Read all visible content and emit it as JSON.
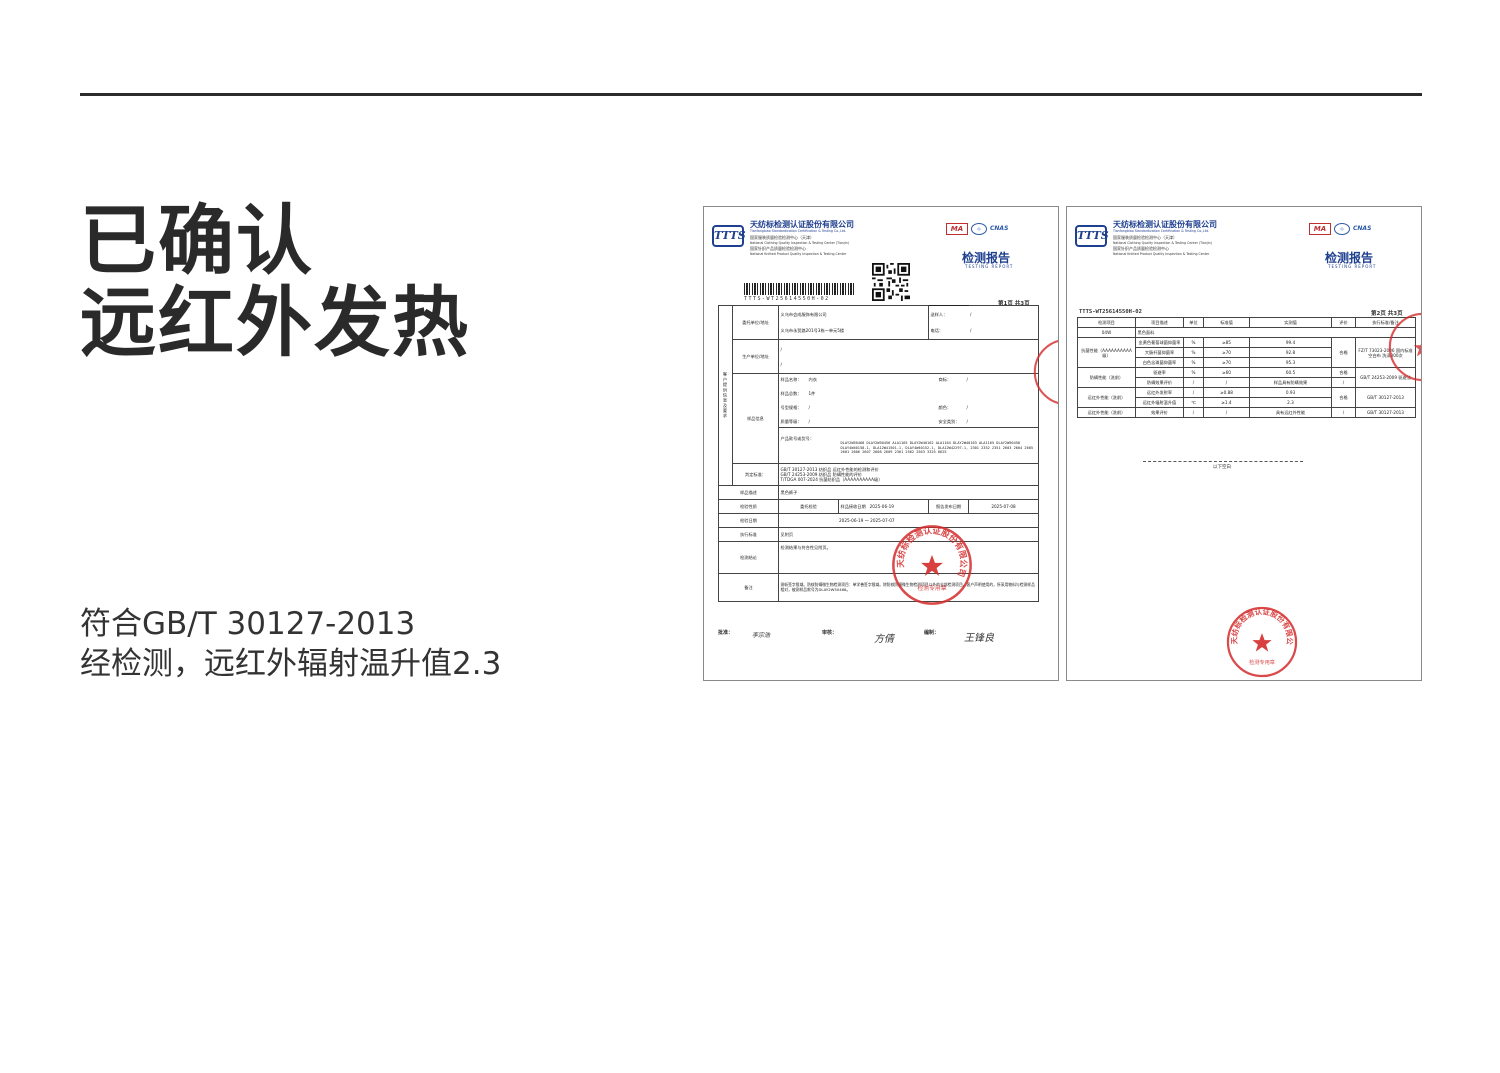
{
  "headline": {
    "line1": "已确认",
    "line2": "远红外发热"
  },
  "description": {
    "line1": "符合GB/T 30127-2013",
    "line2": "经检测，远红外辐射温升值2.3"
  },
  "lab": {
    "logo": "TTTS",
    "name": "天纺标检测认证股份有限公司",
    "name_en": "Tianfangbiao Standardization Certification & Testing Co.,Ltd.",
    "sub1": "国家服装质量检验检测中心（天津）",
    "sub1_en": "National Clothing Quality Inspection & Testing Center (Tianjin)",
    "sub2": "国家针织产品质量检验检测中心",
    "sub2_en": "National Knitted Product Quality Inspection & Testing Center",
    "mark_ma": "MA",
    "mark_cnas": "CNAS"
  },
  "report_title": "检测报告",
  "report_title_en": "TESTING REPORT",
  "page1": {
    "barcode_number": "TTTS-WT25614550H-02",
    "page_label": "第1页 共3页",
    "client_group": "客户提供信息及要求",
    "rows": {
      "client_label": "委托单位/地址",
      "client_name": "义乌市会成服饰有限公司",
      "client_addr": "义乌市永贸路201号3栋一单元5楼",
      "sender_label": "送样人：",
      "sender_val": "/",
      "phone_label": "电话：",
      "phone_val": "/",
      "producer_label": "生产单位/地址",
      "producer_val1": "/",
      "producer_val2": "/",
      "sample_info_label": "样品信息",
      "sample_name_label": "样品名称：",
      "sample_name": "内衣",
      "brand_label": "商标：",
      "brand_val": "/",
      "qty_label": "样品总数：",
      "qty_val": "1件",
      "model_label": "号型规格：",
      "model_val": "/",
      "color_label": "颜色：",
      "color_val": "/",
      "grade_label": "质量等级：",
      "grade_val": "/",
      "safety_label": "安全类别：",
      "safety_val": "/",
      "product_no_label": "产品款号或货号：",
      "product_no_val": "DLAY2W50468 DLAY2W50456 ALA1165 DLAY2W40162 ALA1164 DLAY2W40163 ALA1165 DLAY2W50450 DLAY4W40158-1, DLA12W41501-1, DLAY4W40152-1, DLA12W42297-1, 2301 2352 2351 2603 2604 2605 2601 2606 2607 2608 2609 2301 2562 2563 3325 6625",
      "standard_label": "判定标准：",
      "standard_val1": "GB/T 30127-2013 纺织品 远红外性能的检测和评价",
      "standard_val2": "GB/T 24253-2009 纺织品 防螨性能的评价",
      "standard_val3": "T/TDGA 007-2024 抗菌纺织品（AAAAAAAAAA级）",
      "sample_desc_label": "样品描述",
      "sample_desc_val": "黑色裤子",
      "test_type_label": "检验性质",
      "test_type_val": "委托检验",
      "receive_label": "样品接收日期",
      "receive_val": "2025-06-19",
      "issue_label": "报告发布日期",
      "issue_val": "2025-07-08",
      "test_date_label": "检验日期",
      "test_date_val": "2025-06-19 ～ 2025-07-07",
      "exec_std_label": "执行标准",
      "exec_std_val": "见附页",
      "conclusion_label": "检测结论",
      "conclusion_val": "检测结果与符合性见附页。",
      "remark_label": "备注",
      "remark_val": "测斩签字限域。防蚊防螨微生物检测项目：单学善签字限域。除防蚊防螨微生物检测项目以外的全部检测项目。客户声明使用的，所采用物料与检测样品相对，被测样品款号为DLAY2W50468。"
    },
    "signatures": {
      "approve_label": "批准：",
      "approve_sig": "李宗浩",
      "review_label": "审核：",
      "review_sig": "方倩",
      "prepare_label": "编制：",
      "prepare_sig": "王锋良"
    },
    "stamp_text": "天纺标检测认证股份有限公司",
    "stamp_sub": "检测专用章"
  },
  "page2": {
    "report_no": "TTTS-WT25614550H-02",
    "page_label": "第2页 共3页",
    "headers": [
      "检测项目",
      "项目描述",
      "单位",
      "标准值",
      "实测值",
      "评价",
      "执行标准/备注"
    ],
    "sample_row": [
      "04W",
      "黑色面料"
    ],
    "rows": [
      {
        "item": "抗菌性能（AAAAAAAAAA级）",
        "desc": "金黄色葡萄球菌抑菌率",
        "unit": "%",
        "std": "≥85",
        "val": "99.4",
        "eval": "合格",
        "note": "FZ/T 73023-2006 国内标准空白布 洗涤300次"
      },
      {
        "item": "",
        "desc": "大肠杆菌抑菌率",
        "unit": "%",
        "std": "≥70",
        "val": "92.8",
        "eval": "",
        "note": ""
      },
      {
        "item": "",
        "desc": "白色念珠菌抑菌率",
        "unit": "%",
        "std": "≥70",
        "val": "95.3",
        "eval": "",
        "note": ""
      },
      {
        "item": "防螨性能（洗前）",
        "desc": "驱避率",
        "unit": "%",
        "std": "≥60",
        "val": "60.5",
        "eval": "合格",
        "note": "GB/T 24253-2009 驱避法"
      },
      {
        "item": "",
        "desc": "防螨效果评价",
        "unit": "/",
        "std": "/",
        "val": "样品具有防螨效果",
        "eval": "/",
        "note": ""
      },
      {
        "item": "远红外性能（洗前）",
        "desc": "远红外发射率",
        "unit": "/",
        "std": "≥0.88",
        "val": "0.93",
        "eval": "合格",
        "note": "GB/T 30127-2013"
      },
      {
        "item": "",
        "desc": "远红外辐射温升值",
        "unit": "℃",
        "std": "≥1.4",
        "val": "2.3",
        "eval": "",
        "note": ""
      },
      {
        "item": "远红外性能（洗前）",
        "desc": "效果评价",
        "unit": "/",
        "std": "/",
        "val": "具有远红外性能",
        "eval": "/",
        "note": "GB/T 30127-2013"
      }
    ],
    "empty_text": "以下空白",
    "stamp_text": "天纺标检测认证股份有限公司",
    "stamp_sub": "检测专用章"
  },
  "colors": {
    "brand_blue": "#1f3f8f",
    "stamp_red": "#d42a2a",
    "rule": "#2b2b2b",
    "headline": "#2a2a2a"
  }
}
